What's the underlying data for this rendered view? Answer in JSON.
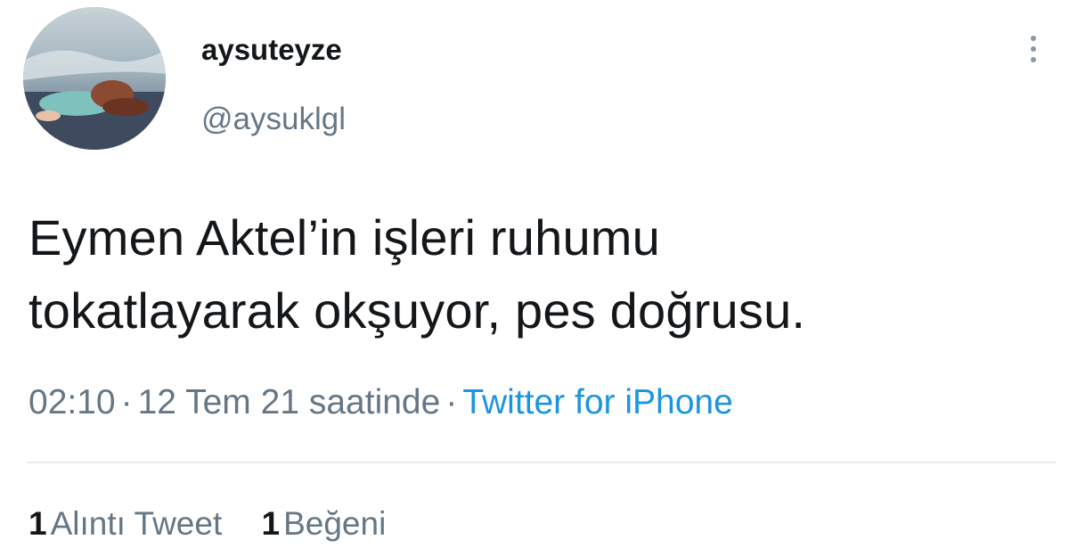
{
  "user": {
    "display_name": "aysuteyze",
    "handle": "@aysuklgl"
  },
  "tweet": {
    "lines": [
      "Eymen Aktel’in işleri ruhumu",
      "tokatlayarak okşuyor, pes doğrusu."
    ]
  },
  "meta": {
    "time": "02:10",
    "separator": "·",
    "date": "12 Tem 21 saatinde",
    "source": "Twitter for iPhone"
  },
  "stats": {
    "quotes": {
      "count": "1",
      "label": "Alıntı Tweet"
    },
    "likes": {
      "count": "1",
      "label": "Beğeni"
    }
  },
  "icons": {
    "more": "more-vertical-icon"
  },
  "colors": {
    "text": "#14171a",
    "secondary": "#657786",
    "link": "#1b95e0",
    "divider": "#e6ecf0"
  }
}
